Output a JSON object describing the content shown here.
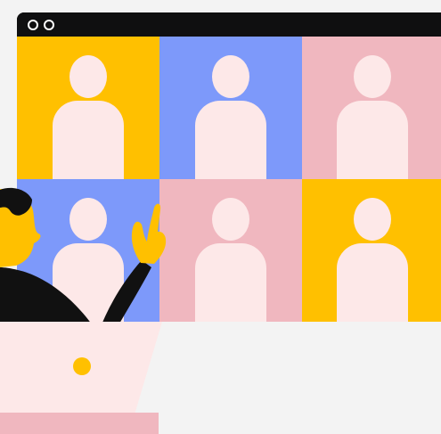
{
  "app": {
    "title": "",
    "window_controls": [
      "circle-icon",
      "circle-icon"
    ]
  },
  "grid": {
    "tiles": [
      {
        "color": "#ffc000"
      },
      {
        "color": "#7d99fa"
      },
      {
        "color": "#f0b7bf"
      },
      {
        "color": "#7d99fa"
      },
      {
        "color": "#f0b7bf"
      },
      {
        "color": "#ffc000"
      }
    ]
  },
  "laptop": {
    "color": "#fde8e8",
    "base_color": "#f0b7bf",
    "dot_color": "#ffc000"
  }
}
